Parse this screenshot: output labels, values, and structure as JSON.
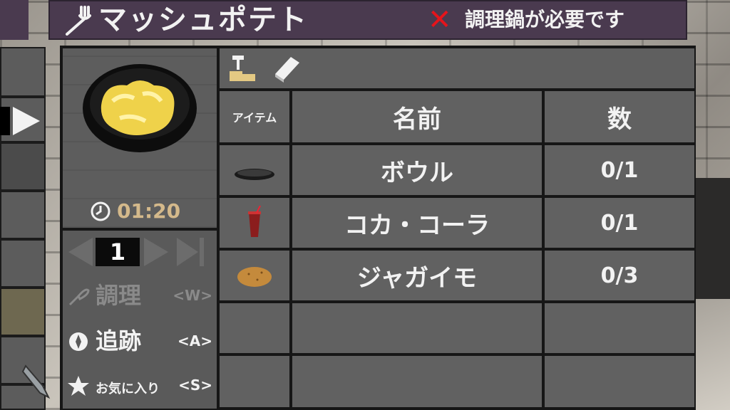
{
  "title": {
    "recipe_name": "マッシュポテト",
    "requirement_text": "調理鍋が必要です",
    "icons": [
      "fork-icon",
      "x-icon"
    ]
  },
  "recipe": {
    "craft_time": "01:20",
    "quantity": "1"
  },
  "actions": [
    {
      "label": "調理",
      "key": "<W>",
      "icon": "whisk-icon",
      "enabled": false
    },
    {
      "label": "追跡",
      "key": "<A>",
      "icon": "compass-icon",
      "enabled": true
    },
    {
      "label": "お気に入り",
      "key": "<S>",
      "icon": "star-icon",
      "enabled": true
    }
  ],
  "toolbar": {
    "icons": [
      "hammer-icon",
      "book-icon"
    ]
  },
  "ingredients": {
    "headers": {
      "item": "アイテム",
      "name": "名前",
      "count": "数"
    },
    "rows": [
      {
        "icon": "bowl-icon",
        "name": "ボウル",
        "count": "0/1"
      },
      {
        "icon": "cola-icon",
        "name": "コカ・コーラ",
        "count": "0/1"
      },
      {
        "icon": "potato-icon",
        "name": "ジャガイモ",
        "count": "0/3"
      }
    ]
  },
  "colors": {
    "title_bar": "#4a3a4f",
    "accent_time": "#d4b98b",
    "error_x": "#e5141b",
    "panel": "#616161"
  }
}
